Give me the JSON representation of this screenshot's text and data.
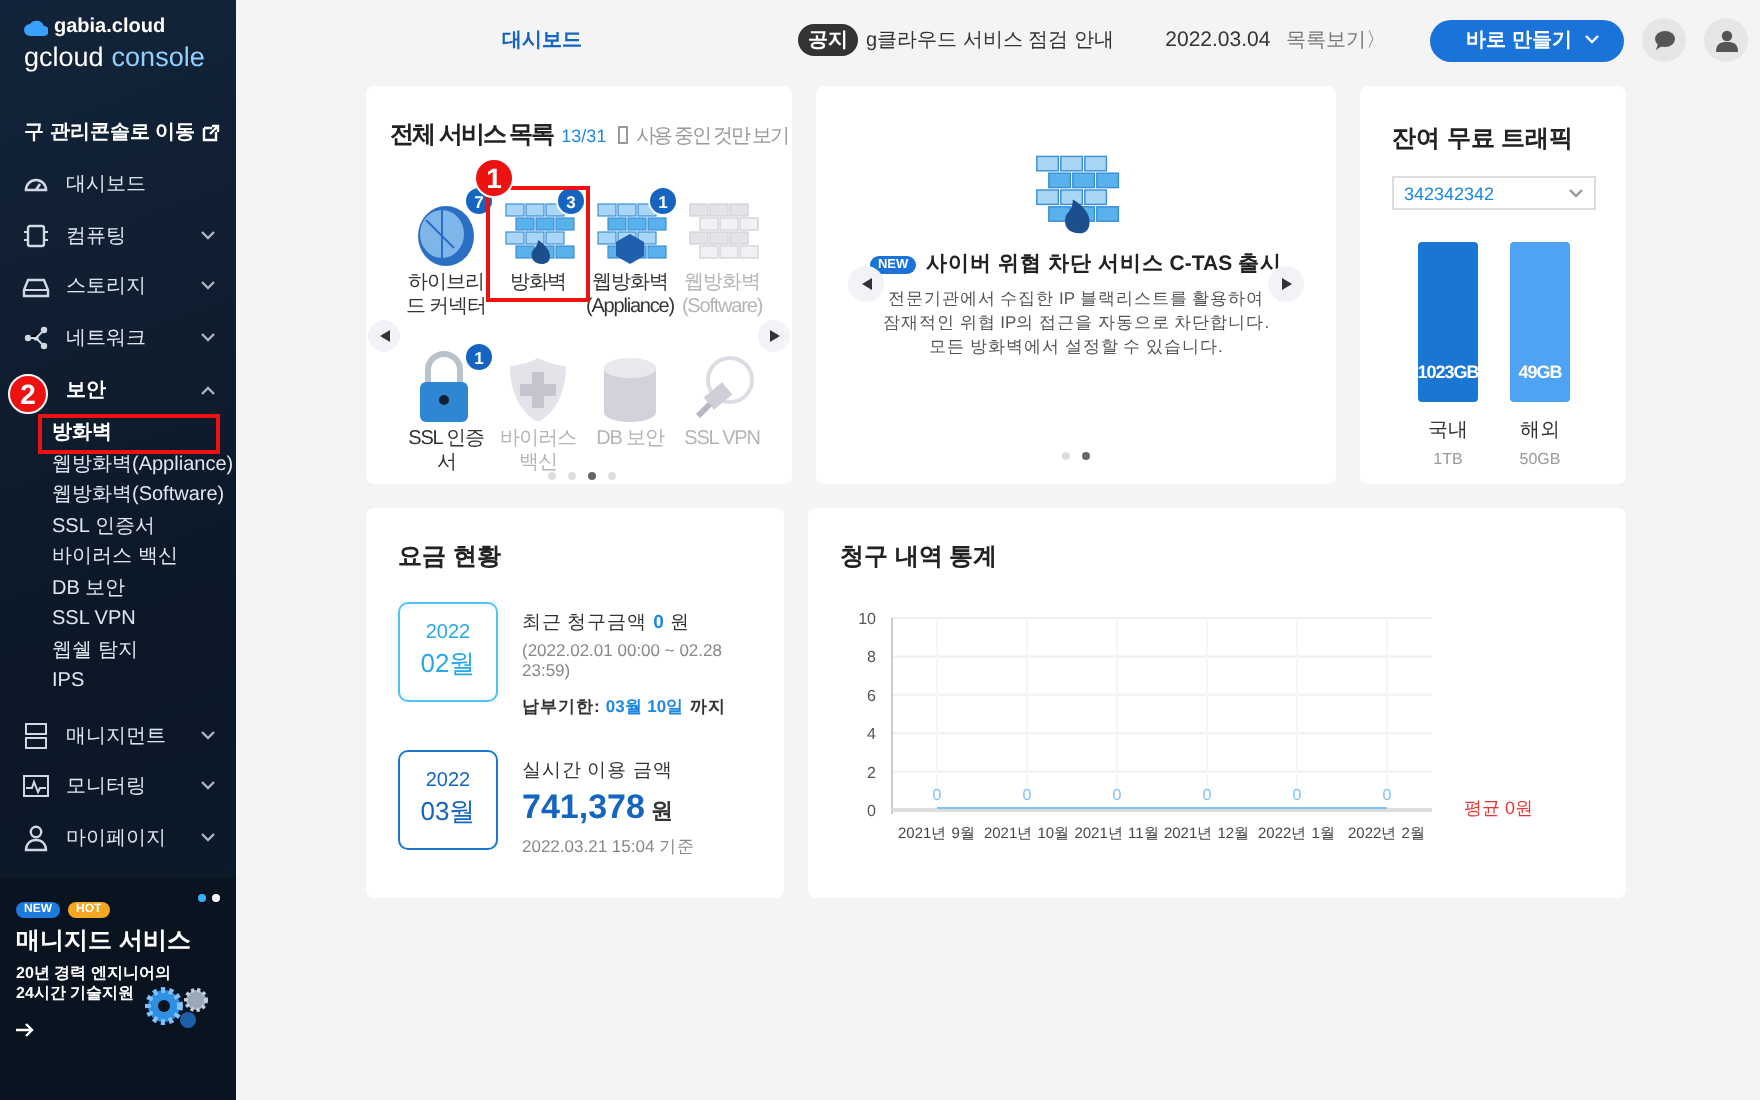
{
  "sidebar": {
    "brand": "gabia.cloud",
    "product": [
      "gcloud",
      "console"
    ],
    "legacy_link": "구 관리콘솔로 이동",
    "menu": [
      {
        "label": "대시보드",
        "kind": "link"
      },
      {
        "label": "컴퓨팅",
        "kind": "group",
        "expanded": false
      },
      {
        "label": "스토리지",
        "kind": "group",
        "expanded": false
      },
      {
        "label": "네트워크",
        "kind": "group",
        "expanded": false
      },
      {
        "label": "보안",
        "kind": "group",
        "expanded": true,
        "children": [
          {
            "label": "방화벽",
            "selected": true
          },
          {
            "label": "웹방화벽(Appliance)",
            "selected": false
          },
          {
            "label": "웹방화벽(Software)",
            "selected": false
          },
          {
            "label": "SSL 인증서",
            "selected": false
          },
          {
            "label": "바이러스 백신",
            "selected": false
          },
          {
            "label": "DB 보안",
            "selected": false
          },
          {
            "label": "SSL VPN",
            "selected": false
          },
          {
            "label": "웹쉘 탐지",
            "selected": false
          },
          {
            "label": "IPS",
            "selected": false
          }
        ]
      },
      {
        "label": "매니지먼트",
        "kind": "group",
        "expanded": false
      },
      {
        "label": "모니터링",
        "kind": "group",
        "expanded": false
      },
      {
        "label": "마이페이지",
        "kind": "group",
        "expanded": false
      }
    ],
    "promo": {
      "dots": [
        {
          "selected": true
        },
        {
          "selected": false
        }
      ],
      "badges": [
        {
          "label": "NEW",
          "color": "#1f7ae0"
        },
        {
          "label": "HOT",
          "color": "#f5a623"
        }
      ],
      "title": "매니지드 서비스",
      "desc": [
        "20년 경력 엔지니어의",
        "24시간 기술지원"
      ]
    }
  },
  "header": {
    "breadcrumb": "대시보드",
    "notice_tag": "공지",
    "notice": "g클라우드 서비스 점검 안내",
    "date": "2022.03.04",
    "list_link": "목록보기〉",
    "create_button": "바로 만들기"
  },
  "services": {
    "title": "전체 서비스 목록",
    "count": "13/31",
    "filter": {
      "label": "사용 중인 것만 보기",
      "checked": false
    },
    "items": [
      {
        "label": "하이브리드 커넥터",
        "kind": "dish",
        "badge": "7",
        "active": true
      },
      {
        "label": "방화벽",
        "kind": "wall",
        "badge": "3",
        "active": true
      },
      {
        "label": "웹방화벽(Appliance)",
        "kind": "wallhex",
        "badge": "1",
        "active": true
      },
      {
        "label": "웹방화벽(Software)",
        "kind": "wall",
        "active": false
      },
      {
        "label": "SSL 인증서",
        "kind": "lock",
        "badge": "1",
        "active": true
      },
      {
        "label": "바이러스 백신",
        "kind": "vaccine",
        "active": false
      },
      {
        "label": "DB 보안",
        "kind": "db",
        "active": false
      },
      {
        "label": "SSL VPN",
        "kind": "plug",
        "active": false
      }
    ],
    "pages": [
      {
        "selected": false
      },
      {
        "selected": false
      },
      {
        "selected": true
      },
      {
        "selected": false
      }
    ]
  },
  "banner": {
    "tag": "NEW",
    "title": "사이버 위협 차단 서비스 C-TAS 출시",
    "desc": [
      "전문기관에서 수집한 IP 블랙리스트를 활용하여",
      "잠재적인 위협 IP의 접근을 자동으로 차단합니다.",
      "모든 방화벽에서 설정할 수 있습니다."
    ],
    "pages": [
      {
        "selected": false
      },
      {
        "selected": true
      }
    ]
  },
  "traffic": {
    "title": "잔여 무료 트래픽",
    "account": "342342342",
    "bars": [
      {
        "value": "1023GB",
        "label": "국내",
        "total": "1TB",
        "color": "#1976d2"
      },
      {
        "value": "49GB",
        "label": "해외",
        "total": "50GB",
        "color": "#4ea3f5"
      }
    ]
  },
  "billing": {
    "title": "요금 현황",
    "entries": [
      {
        "kind": "billed",
        "year": "2022",
        "month": "02월",
        "label": "최근 청구금액",
        "amount": "0",
        "unit": "원",
        "period": "(2022.02.01 00:00 ~ 02.28 23:59)",
        "due_label": "납부기한:",
        "due_date": "03월 10일",
        "due_suffix": "까지"
      },
      {
        "kind": "realtime",
        "year": "2022",
        "month": "03월",
        "label": "실시간 이용 금액",
        "amount": "741,378",
        "unit": "원",
        "as_of": "2022.03.21 15:04 기준"
      }
    ]
  },
  "stats": {
    "title": "청구 내역 통계",
    "average": "평균 0원",
    "chart_data": {
      "type": "line",
      "categories": [
        "2021년 9월",
        "2021년 10월",
        "2021년 11월",
        "2021년 12월",
        "2022년 1월",
        "2022년 2월"
      ],
      "series": [
        {
          "color": "#7ec2f7",
          "values": [
            0,
            0,
            0,
            0,
            0,
            0
          ]
        }
      ],
      "ylim": [
        0,
        10
      ],
      "yticks": [
        0,
        2,
        4,
        6,
        8,
        10
      ],
      "grid": true,
      "data_labels": true
    }
  },
  "annotations": [
    {
      "label": "1"
    },
    {
      "label": "2"
    }
  ]
}
